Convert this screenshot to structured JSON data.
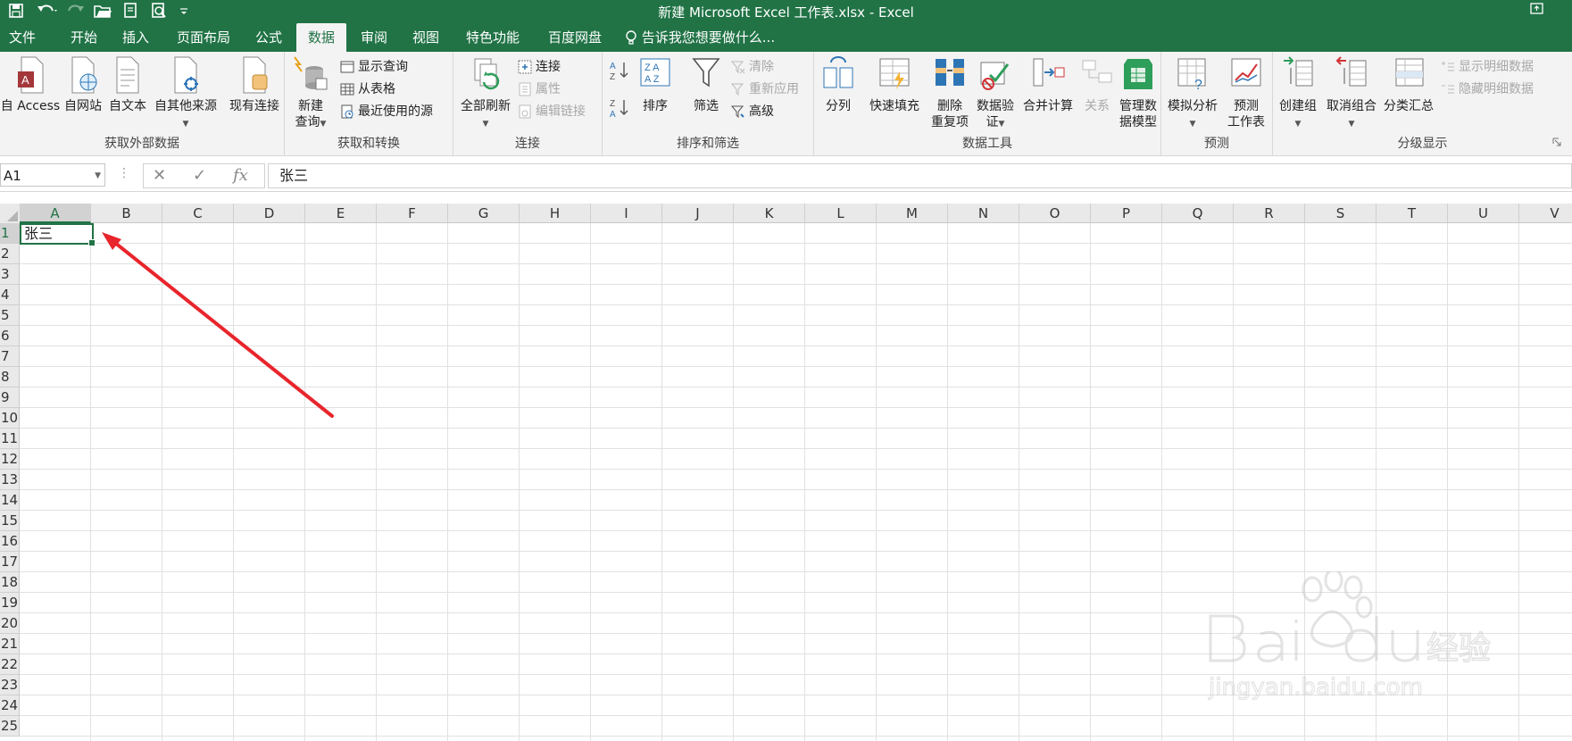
{
  "window": {
    "title": "新建 Microsoft Excel 工作表.xlsx - Excel"
  },
  "tabs": [
    {
      "label": "文件",
      "active": false
    },
    {
      "label": "开始",
      "active": false
    },
    {
      "label": "插入",
      "active": false
    },
    {
      "label": "页面布局",
      "active": false
    },
    {
      "label": "公式",
      "active": false
    },
    {
      "label": "数据",
      "active": true
    },
    {
      "label": "审阅",
      "active": false
    },
    {
      "label": "视图",
      "active": false
    },
    {
      "label": "特色功能",
      "active": false
    },
    {
      "label": "百度网盘",
      "active": false
    }
  ],
  "tellme": "告诉我您想要做什么...",
  "ribbon": {
    "external": {
      "label": "获取外部数据",
      "access": "自 Access",
      "web": "自网站",
      "text": "自文本",
      "other": "自其他来源",
      "existing": "现有连接"
    },
    "transform": {
      "label": "获取和转换",
      "new_query_1": "新建",
      "new_query_2": "查询",
      "show_queries": "显示查询",
      "from_table": "从表格",
      "recent_sources": "最近使用的源"
    },
    "connections": {
      "label": "连接",
      "refresh_all": "全部刷新",
      "connections": "连接",
      "properties": "属性",
      "edit_links": "编辑链接"
    },
    "sort_filter": {
      "label": "排序和筛选",
      "sort": "排序",
      "filter": "筛选",
      "clear": "清除",
      "reapply": "重新应用",
      "advanced": "高级"
    },
    "data_tools": {
      "label": "数据工具",
      "text_to_columns": "分列",
      "flash_fill": "快速填充",
      "remove_dup_1": "删除",
      "remove_dup_2": "重复项",
      "validation_1": "数据验",
      "validation_2": "证",
      "consolidate": "合并计算",
      "relationships": "关系",
      "manage_model_1": "管理数",
      "manage_model_2": "据模型"
    },
    "forecast": {
      "label": "预测",
      "what_if": "模拟分析",
      "forecast_sheet_1": "预测",
      "forecast_sheet_2": "工作表"
    },
    "outline": {
      "label": "分级显示",
      "group": "创建组",
      "ungroup": "取消组合",
      "subtotal": "分类汇总",
      "show_detail": "显示明细数据",
      "hide_detail": "隐藏明细数据"
    }
  },
  "formula_bar": {
    "name_box": "A1",
    "value": "张三"
  },
  "sheet": {
    "columns": [
      "A",
      "B",
      "C",
      "D",
      "E",
      "F",
      "G",
      "H",
      "I",
      "J",
      "K",
      "L",
      "M",
      "N",
      "O",
      "P",
      "Q",
      "R",
      "S",
      "T",
      "U",
      "V"
    ],
    "rows": [
      "1",
      "2",
      "3",
      "4",
      "5",
      "6",
      "7",
      "8",
      "9",
      "10",
      "11",
      "12",
      "13",
      "14",
      "15",
      "16",
      "17",
      "18",
      "19",
      "20",
      "21",
      "22",
      "23",
      "24",
      "25"
    ],
    "selected_cell": "A1",
    "a1_value": "张三"
  },
  "colors": {
    "excel_green": "#217346",
    "arrow_red": "#e8252b"
  }
}
